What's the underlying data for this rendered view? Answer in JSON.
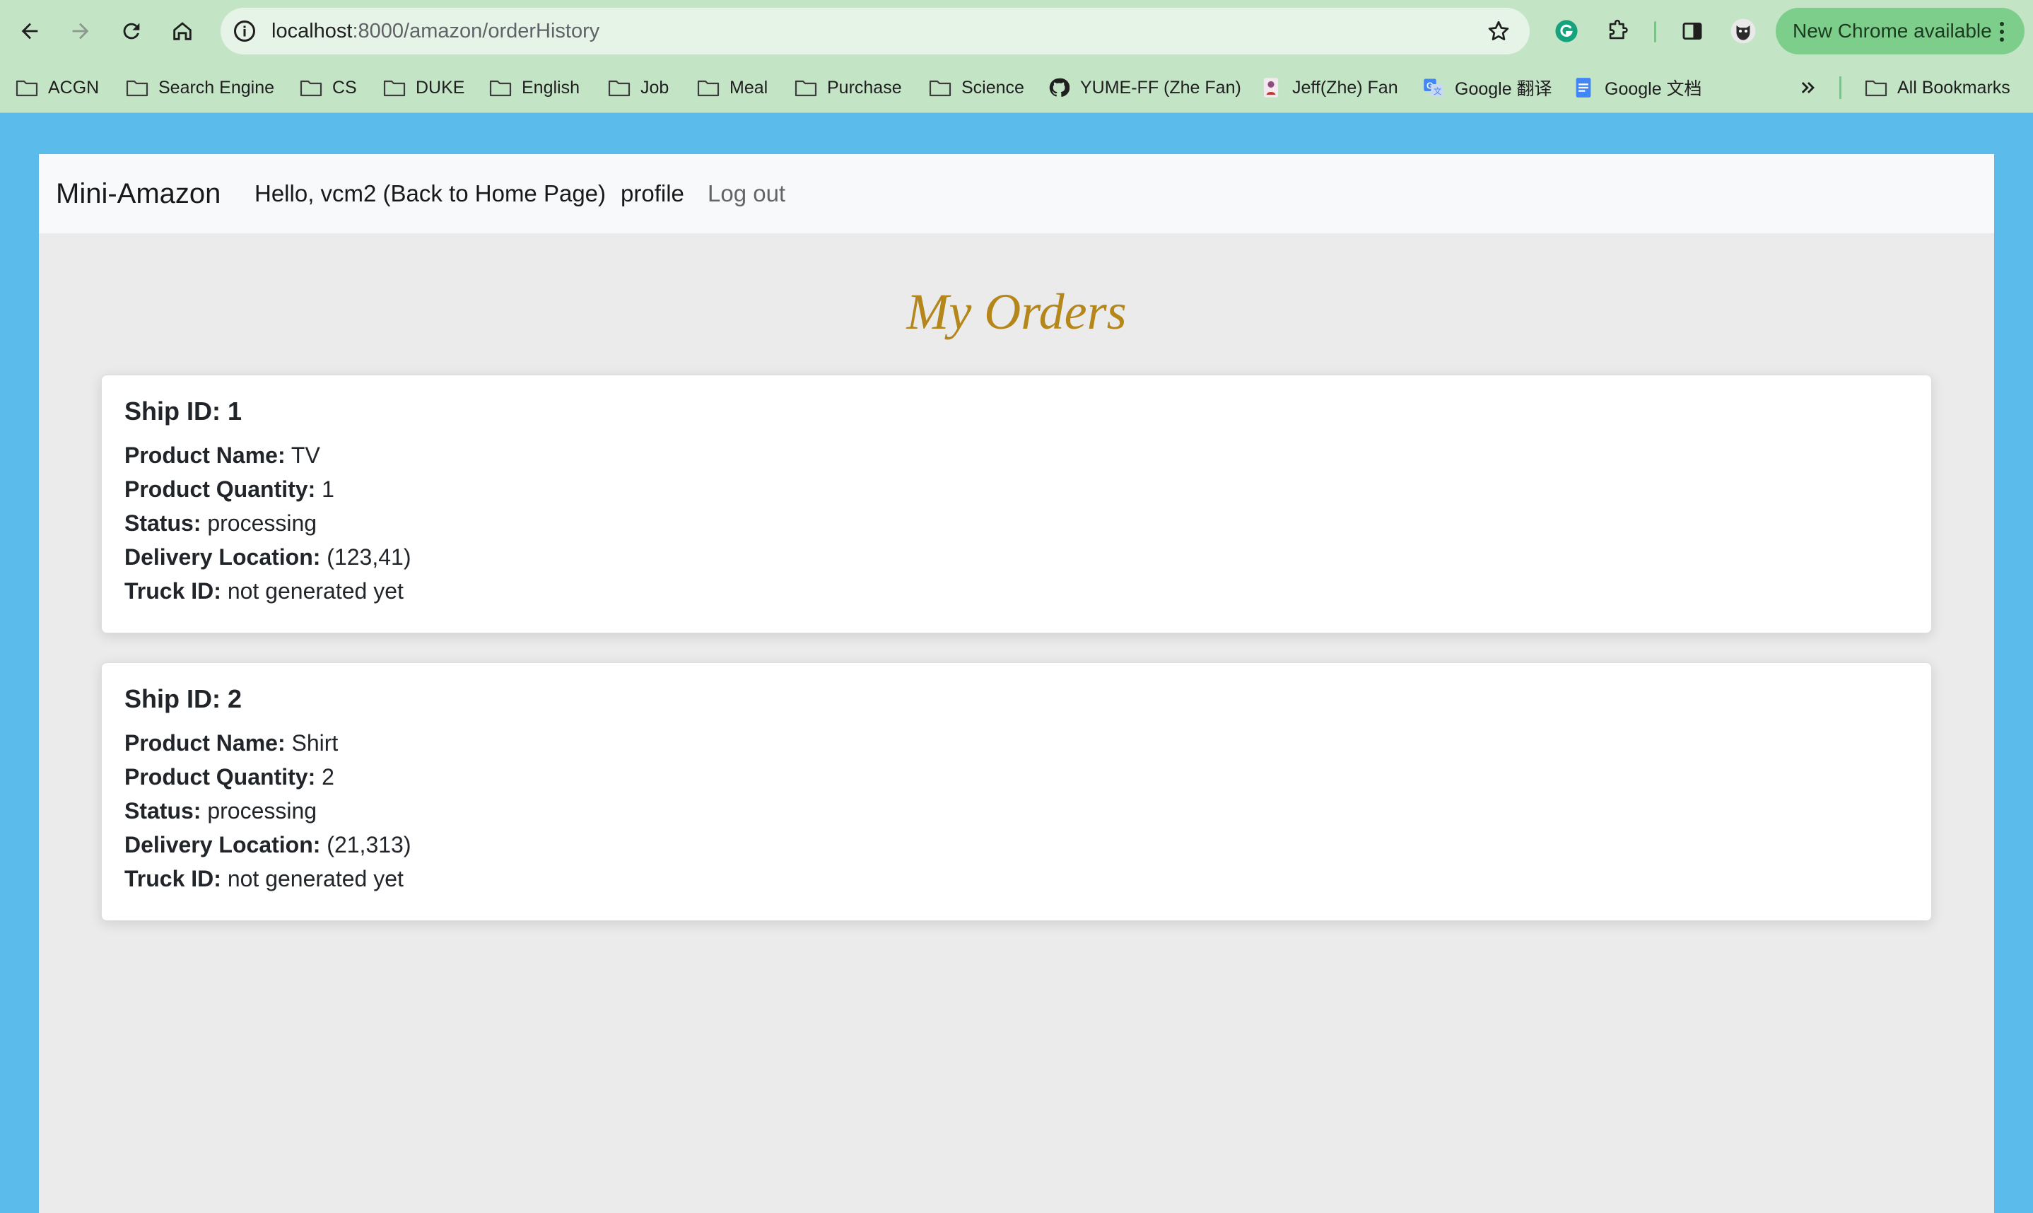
{
  "browser": {
    "url_host": "localhost",
    "url_rest": ":8000/amazon/orderHistory",
    "update_label": "New Chrome available"
  },
  "bookmarks": [
    {
      "label": "ACGN",
      "icon": "folder-icon"
    },
    {
      "label": "Search Engine",
      "icon": "folder-icon"
    },
    {
      "label": "CS",
      "icon": "folder-icon"
    },
    {
      "label": "DUKE",
      "icon": "folder-icon"
    },
    {
      "label": "English",
      "icon": "folder-icon"
    },
    {
      "label": "Job",
      "icon": "folder-icon"
    },
    {
      "label": "Meal",
      "icon": "folder-icon"
    },
    {
      "label": "Purchase",
      "icon": "folder-icon"
    },
    {
      "label": "Science",
      "icon": "folder-icon"
    },
    {
      "label": "YUME-FF (Zhe Fan)",
      "icon": "github-icon"
    },
    {
      "label": "Jeff(Zhe) Fan",
      "icon": "avatar-icon"
    },
    {
      "label": "Google 翻译",
      "icon": "google-translate-icon"
    },
    {
      "label": "Google 文档",
      "icon": "google-docs-icon"
    }
  ],
  "all_bookmarks_label": "All Bookmarks",
  "navbar": {
    "brand": "Mini-Amazon",
    "greeting": "Hello, vcm2 (Back to Home Page)",
    "profile": "profile",
    "logout": "Log out"
  },
  "page_title": "My Orders",
  "field_labels": {
    "ship_id": "Ship ID:",
    "product_name": "Product Name:",
    "product_quantity": "Product Quantity:",
    "status": "Status:",
    "delivery_location": "Delivery Location:",
    "truck_id": "Truck ID:"
  },
  "orders": [
    {
      "ship_id": "1",
      "product_name": "TV",
      "product_quantity": "1",
      "status": "processing",
      "delivery_location": "(123,41)",
      "truck_id": "not generated yet"
    },
    {
      "ship_id": "2",
      "product_name": "Shirt",
      "product_quantity": "2",
      "status": "processing",
      "delivery_location": "(21,313)",
      "truck_id": "not generated yet"
    }
  ],
  "colors": {
    "page_background": "#5bbcec",
    "heading": "#b5871a",
    "chrome_toolbar": "#c4e4c6"
  }
}
